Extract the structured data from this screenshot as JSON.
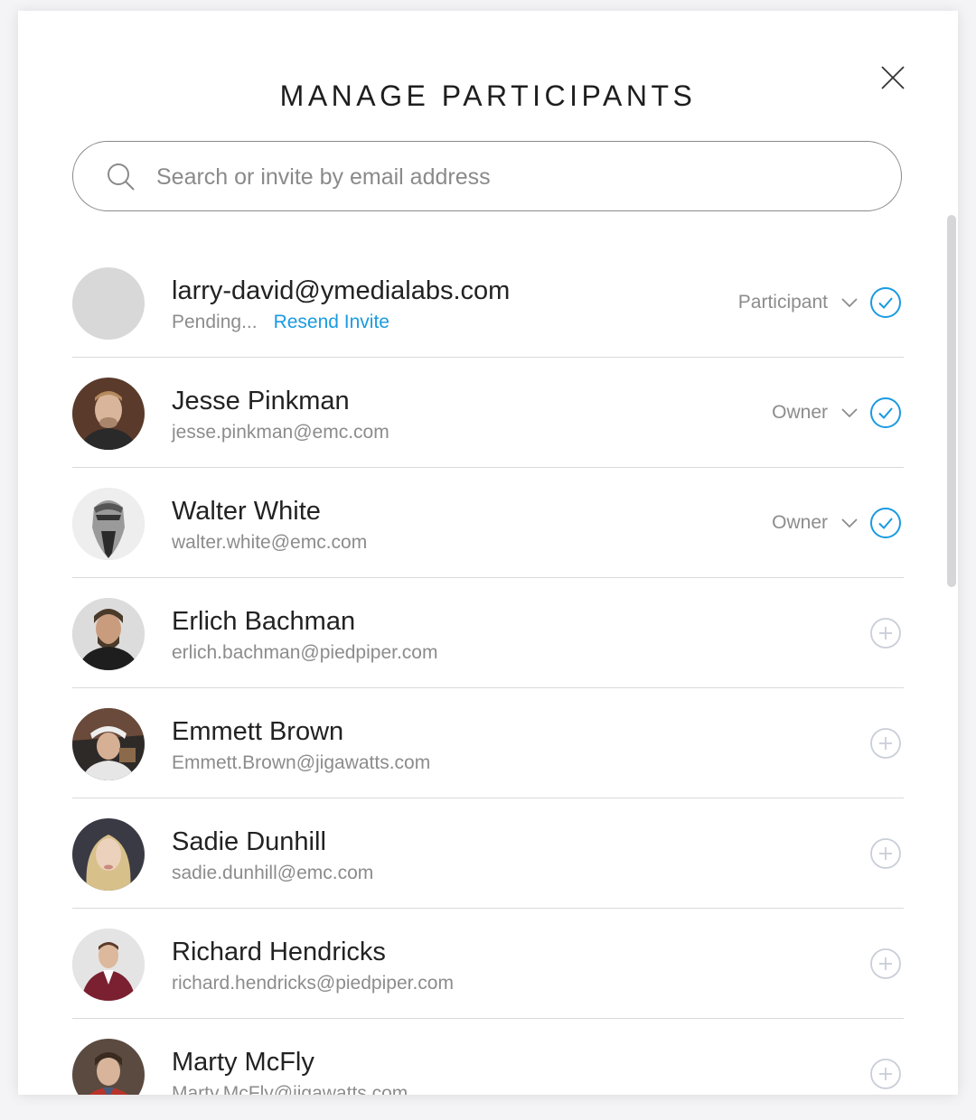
{
  "dialog": {
    "title": "MANAGE PARTICIPANTS"
  },
  "search": {
    "placeholder": "Search or invite by email address"
  },
  "colors": {
    "accent": "#1a9be0",
    "muted": "#8c8c8c",
    "divider": "#d9d9d9"
  },
  "participants": [
    {
      "name": "larry-david@ymedialabs.com",
      "status": "Pending...",
      "resend_label": "Resend Invite",
      "role": "Participant",
      "action_icon": "check-circle-icon",
      "avatar": "placeholder"
    },
    {
      "name": "Jesse Pinkman",
      "email": "jesse.pinkman@emc.com",
      "role": "Owner",
      "action_icon": "check-circle-icon"
    },
    {
      "name": "Walter White",
      "email": "walter.white@emc.com",
      "role": "Owner",
      "action_icon": "check-circle-icon"
    },
    {
      "name": "Erlich Bachman",
      "email": "erlich.bachman@piedpiper.com",
      "action_icon": "add-circle-icon"
    },
    {
      "name": "Emmett Brown",
      "email": "Emmett.Brown@jigawatts.com",
      "action_icon": "add-circle-icon"
    },
    {
      "name": "Sadie Dunhill",
      "email": "sadie.dunhill@emc.com",
      "action_icon": "add-circle-icon"
    },
    {
      "name": "Richard Hendricks",
      "email": "richard.hendricks@piedpiper.com",
      "action_icon": "add-circle-icon"
    },
    {
      "name": "Marty McFly",
      "email": "Marty.McFly@jigawatts.com",
      "action_icon": "add-circle-icon"
    }
  ]
}
